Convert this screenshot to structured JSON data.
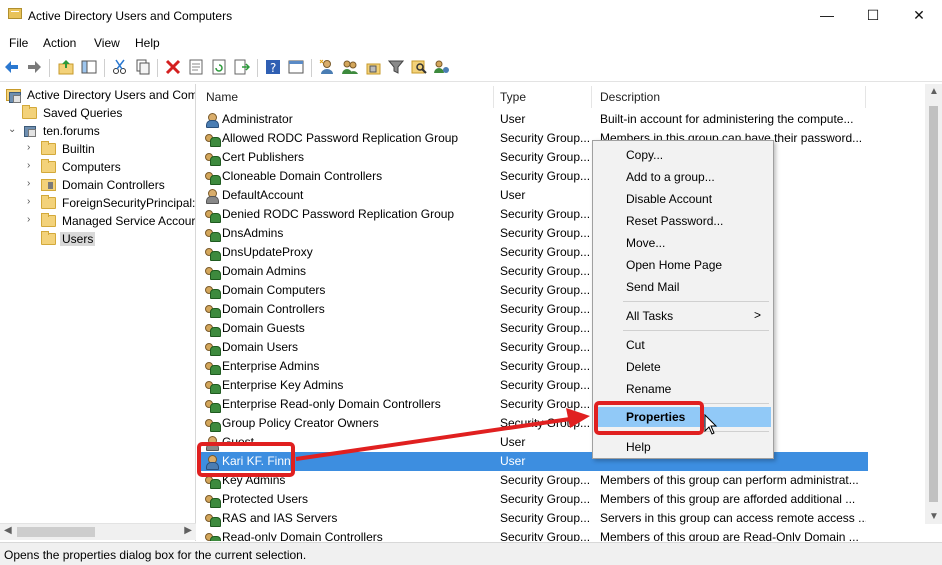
{
  "window": {
    "title": "Active Directory Users and Computers",
    "minimize_glyph": "—",
    "maximize_glyph": "☐",
    "close_glyph": "✕"
  },
  "menu": [
    "File",
    "Action",
    "View",
    "Help"
  ],
  "toolbar_icons": [
    "back-icon",
    "forward-icon",
    "up-folder-icon",
    "show-hide-tree-icon",
    "cut-icon",
    "copy-icon",
    "delete-icon",
    "properties-icon",
    "refresh-icon",
    "export-list-icon",
    "help-icon",
    "mmc-console-icon",
    "new-user-icon",
    "new-group-icon",
    "new-ou-icon",
    "filter-icon",
    "find-icon",
    "add-to-group-icon"
  ],
  "tree": {
    "root": "Active Directory Users and Com",
    "saved_queries": "Saved Queries",
    "domain": "ten.forums",
    "children": [
      "Builtin",
      "Computers",
      "Domain Controllers",
      "ForeignSecurityPrincipal:",
      "Managed Service Accour",
      "Users"
    ],
    "selected": "Users"
  },
  "list": {
    "columns": [
      "Name",
      "Type",
      "Description"
    ],
    "rows": [
      {
        "name": "Administrator",
        "type": "User",
        "description": "Built-in account for administering the compute..."
      },
      {
        "name": "Allowed RODC Password Replication Group",
        "type": "Security Group...",
        "description": "Members in this group can have their password..."
      },
      {
        "name": "Cert Publishers",
        "type": "Security Group...",
        "description": "tted to publish..."
      },
      {
        "name": "Cloneable Domain Controllers",
        "type": "Security Group...",
        "description": "omain controll..."
      },
      {
        "name": "DefaultAccount",
        "type": "User",
        "description": "ystem."
      },
      {
        "name": "Denied RODC Password Replication Group",
        "type": "Security Group...",
        "description": "ve their passw..."
      },
      {
        "name": "DnsAdmins",
        "type": "Security Group...",
        "description": ""
      },
      {
        "name": "DnsUpdateProxy",
        "type": "Security Group...",
        "description": "perform dyna..."
      },
      {
        "name": "Domain Admins",
        "type": "Security Group...",
        "description": "domain"
      },
      {
        "name": "Domain Computers",
        "type": "Security Group...",
        "description": "d to the domain"
      },
      {
        "name": "Domain Controllers",
        "type": "Security Group...",
        "description": "ain"
      },
      {
        "name": "Domain Guests",
        "type": "Security Group...",
        "description": ""
      },
      {
        "name": "Domain Users",
        "type": "Security Group...",
        "description": ""
      },
      {
        "name": "Enterprise Admins",
        "type": "Security Group...",
        "description": "enterprise"
      },
      {
        "name": "Enterprise Key Admins",
        "type": "Security Group...",
        "description": "rform administrat..."
      },
      {
        "name": "Enterprise Read-only Domain Controllers",
        "type": "Security Group...",
        "description": "Only Domain ..."
      },
      {
        "name": "Group Policy Creator Owners",
        "type": "Security Group...",
        "description": "fy group policy..."
      },
      {
        "name": "Guest",
        "type": "User",
        "description": "to the comput..."
      },
      {
        "name": "Kari KF. Finn",
        "type": "User",
        "description": ""
      },
      {
        "name": "Key Admins",
        "type": "Security Group...",
        "description": "Members of this group can perform administrat..."
      },
      {
        "name": "Protected Users",
        "type": "Security Group...",
        "description": "Members of this group are afforded additional ..."
      },
      {
        "name": "RAS and IAS Servers",
        "type": "Security Group...",
        "description": "Servers in this group can access remote access ..."
      },
      {
        "name": "Read-only Domain Controllers",
        "type": "Security Group...",
        "description": "Members of this group are Read-Only Domain ..."
      }
    ]
  },
  "context_menu": {
    "items": [
      "Copy...",
      "Add to a group...",
      "Disable Account",
      "Reset Password...",
      "Move...",
      "Open Home Page",
      "Send Mail",
      "All Tasks",
      "Cut",
      "Delete",
      "Rename",
      "Properties",
      "Help"
    ],
    "submenu_arrow": ">"
  },
  "status": "Opens the properties dialog box for the current selection.",
  "colors": {
    "selection": "#3d8ee0",
    "menu_highlight": "#91c9f7",
    "callout": "#e02020"
  }
}
